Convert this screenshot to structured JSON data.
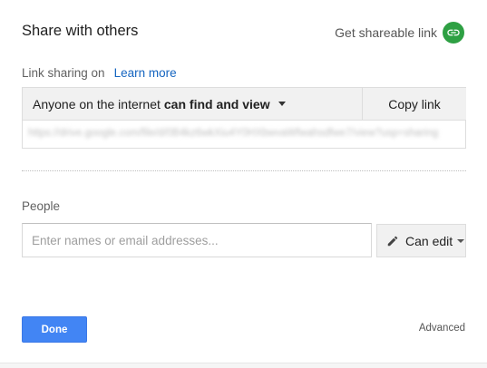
{
  "dialog": {
    "title": "Share with others",
    "get_link_label": "Get shareable link"
  },
  "link_sharing": {
    "label": "Link sharing on",
    "learn_more": "Learn more",
    "access_prefix": "Anyone on the internet",
    "access_level": "can find and view",
    "copy_label": "Copy link",
    "url": "https://drive.google.com/file/d/0B4kz6wkXiu4Y0HXbwvaWfwahsdfwe7/view?usp=sharing"
  },
  "people": {
    "label": "People",
    "placeholder": "Enter names or email addresses...",
    "permission": "Can edit"
  },
  "footer": {
    "done_label": "Done",
    "advanced_label": "Advanced"
  },
  "colors": {
    "accent_blue": "#4285f4",
    "link_blue": "#1565c0",
    "share_green": "#2ea043"
  },
  "icons": {
    "share": "link-icon",
    "access": "caret-down-icon",
    "permission": "pencil-icon",
    "permission_menu": "caret-down-icon"
  }
}
